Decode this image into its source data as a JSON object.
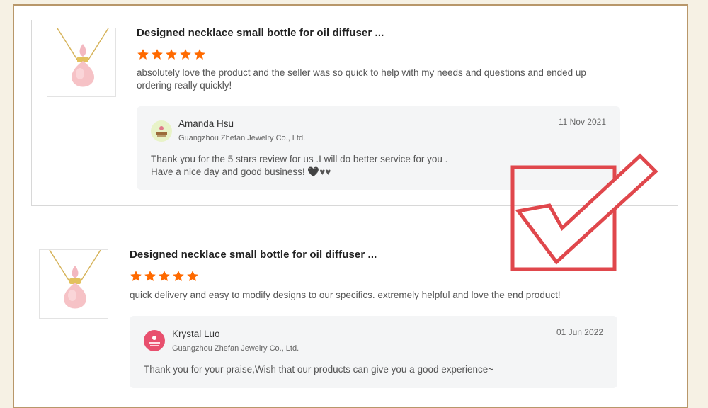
{
  "reviews": [
    {
      "product_title": "Designed necklace small bottle for oil diffuser ...",
      "rating": 5,
      "text_lines": [
        "absolutely love the product and the seller was so quick to help with my needs and questions and ended up",
        "ordering really quickly!"
      ],
      "reply": {
        "name": "Amanda Hsu",
        "company": "Guangzhou Zhefan Jewelry Co., Ltd.",
        "date": "11 Nov 2021",
        "lines": [
          "Thank you for the 5 stars review for us .I will do better service for you .",
          "Have a nice day and good business!  🖤♥♥"
        ],
        "avatar_color": "#e8f3c8"
      }
    },
    {
      "product_title": "Designed necklace small bottle for oil diffuser ...",
      "rating": 5,
      "text_lines": [
        "quick delivery and easy to modify designs to our specifics. extremely helpful and love the end product!"
      ],
      "reply": {
        "name": "Krystal Luo",
        "company": "Guangzhou Zhefan Jewelry Co., Ltd.",
        "date": "01 Jun 2022",
        "lines": [
          "Thank you for your praise,Wish that our products can give you a good experience~"
        ],
        "avatar_color": "#e8506e"
      }
    }
  ],
  "colors": {
    "star": "#ff6a00",
    "check": "#e0474c",
    "frame": "#b8976a",
    "background": "#f6f1e4"
  },
  "icons": [
    "star-icon",
    "necklace-product-image",
    "seller-avatar",
    "checkmark-icon"
  ]
}
